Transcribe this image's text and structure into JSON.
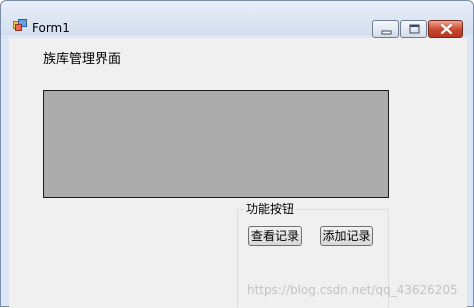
{
  "window": {
    "title": "Form1",
    "controls": {
      "minimize_icon": "minimize-icon",
      "maximize_icon": "maximize-icon",
      "close_icon": "close-icon"
    },
    "app_icon": "form-icon"
  },
  "form": {
    "heading": "族库管理界面",
    "group": {
      "label": "功能按钮",
      "buttons": {
        "view_label": "查看记录",
        "add_label": "添加记录"
      }
    }
  },
  "watermark": "https://blog.csdn.net/qq_43626205",
  "colors": {
    "grid_background": "#ababab",
    "client_background": "#f0f0f0",
    "titlebar": "#d3deee",
    "close_button": "#c8452f"
  }
}
